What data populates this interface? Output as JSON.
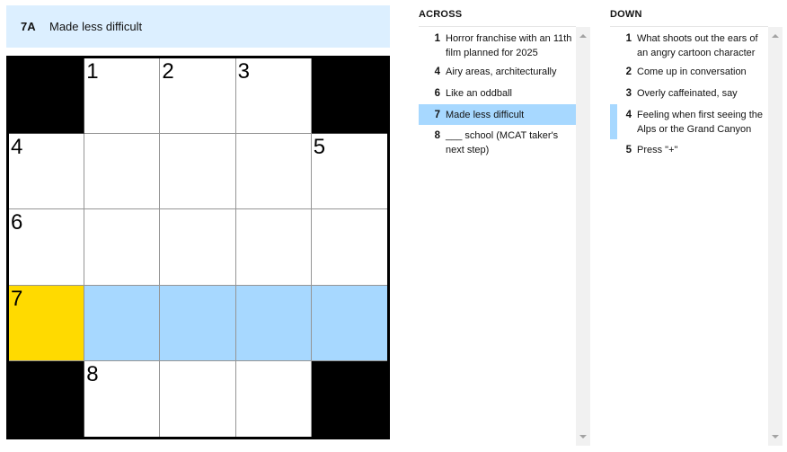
{
  "current_clue": {
    "number": "7A",
    "text": "Made less difficult"
  },
  "colors": {
    "word_highlight": "#a7d8ff",
    "selected_cell": "#ffda00",
    "clue_bar": "#dcefff"
  },
  "grid": {
    "rows": 5,
    "cols": 5,
    "cells": [
      [
        {
          "block": true
        },
        {
          "label": "1"
        },
        {
          "label": "2"
        },
        {
          "label": "3"
        },
        {
          "block": true
        }
      ],
      [
        {
          "label": "4"
        },
        {},
        {},
        {},
        {
          "label": "5"
        }
      ],
      [
        {
          "label": "6"
        },
        {},
        {},
        {},
        {}
      ],
      [
        {
          "label": "7",
          "selected": true
        },
        {
          "word": true
        },
        {
          "word": true
        },
        {
          "word": true
        },
        {
          "word": true
        }
      ],
      [
        {
          "block": true
        },
        {
          "label": "8"
        },
        {},
        {},
        {
          "block": true
        }
      ]
    ]
  },
  "across": {
    "title": "ACROSS",
    "clues": [
      {
        "num": "1",
        "text": "Horror franchise with an 11th film planned for 2025"
      },
      {
        "num": "4",
        "text": "Airy areas, architecturally"
      },
      {
        "num": "6",
        "text": "Like an oddball"
      },
      {
        "num": "7",
        "text": "Made less difficult",
        "active": true
      },
      {
        "num": "8",
        "text": "___ school (MCAT taker's next step)"
      }
    ]
  },
  "down": {
    "title": "DOWN",
    "clues": [
      {
        "num": "1",
        "text": "What shoots out the ears of an angry cartoon character"
      },
      {
        "num": "2",
        "text": "Come up in conversation"
      },
      {
        "num": "3",
        "text": "Overly caffeinated, say"
      },
      {
        "num": "4",
        "text": "Feeling when first seeing the Alps or the Grand Canyon",
        "crossing": true
      },
      {
        "num": "5",
        "text": "Press \"+\""
      }
    ]
  }
}
